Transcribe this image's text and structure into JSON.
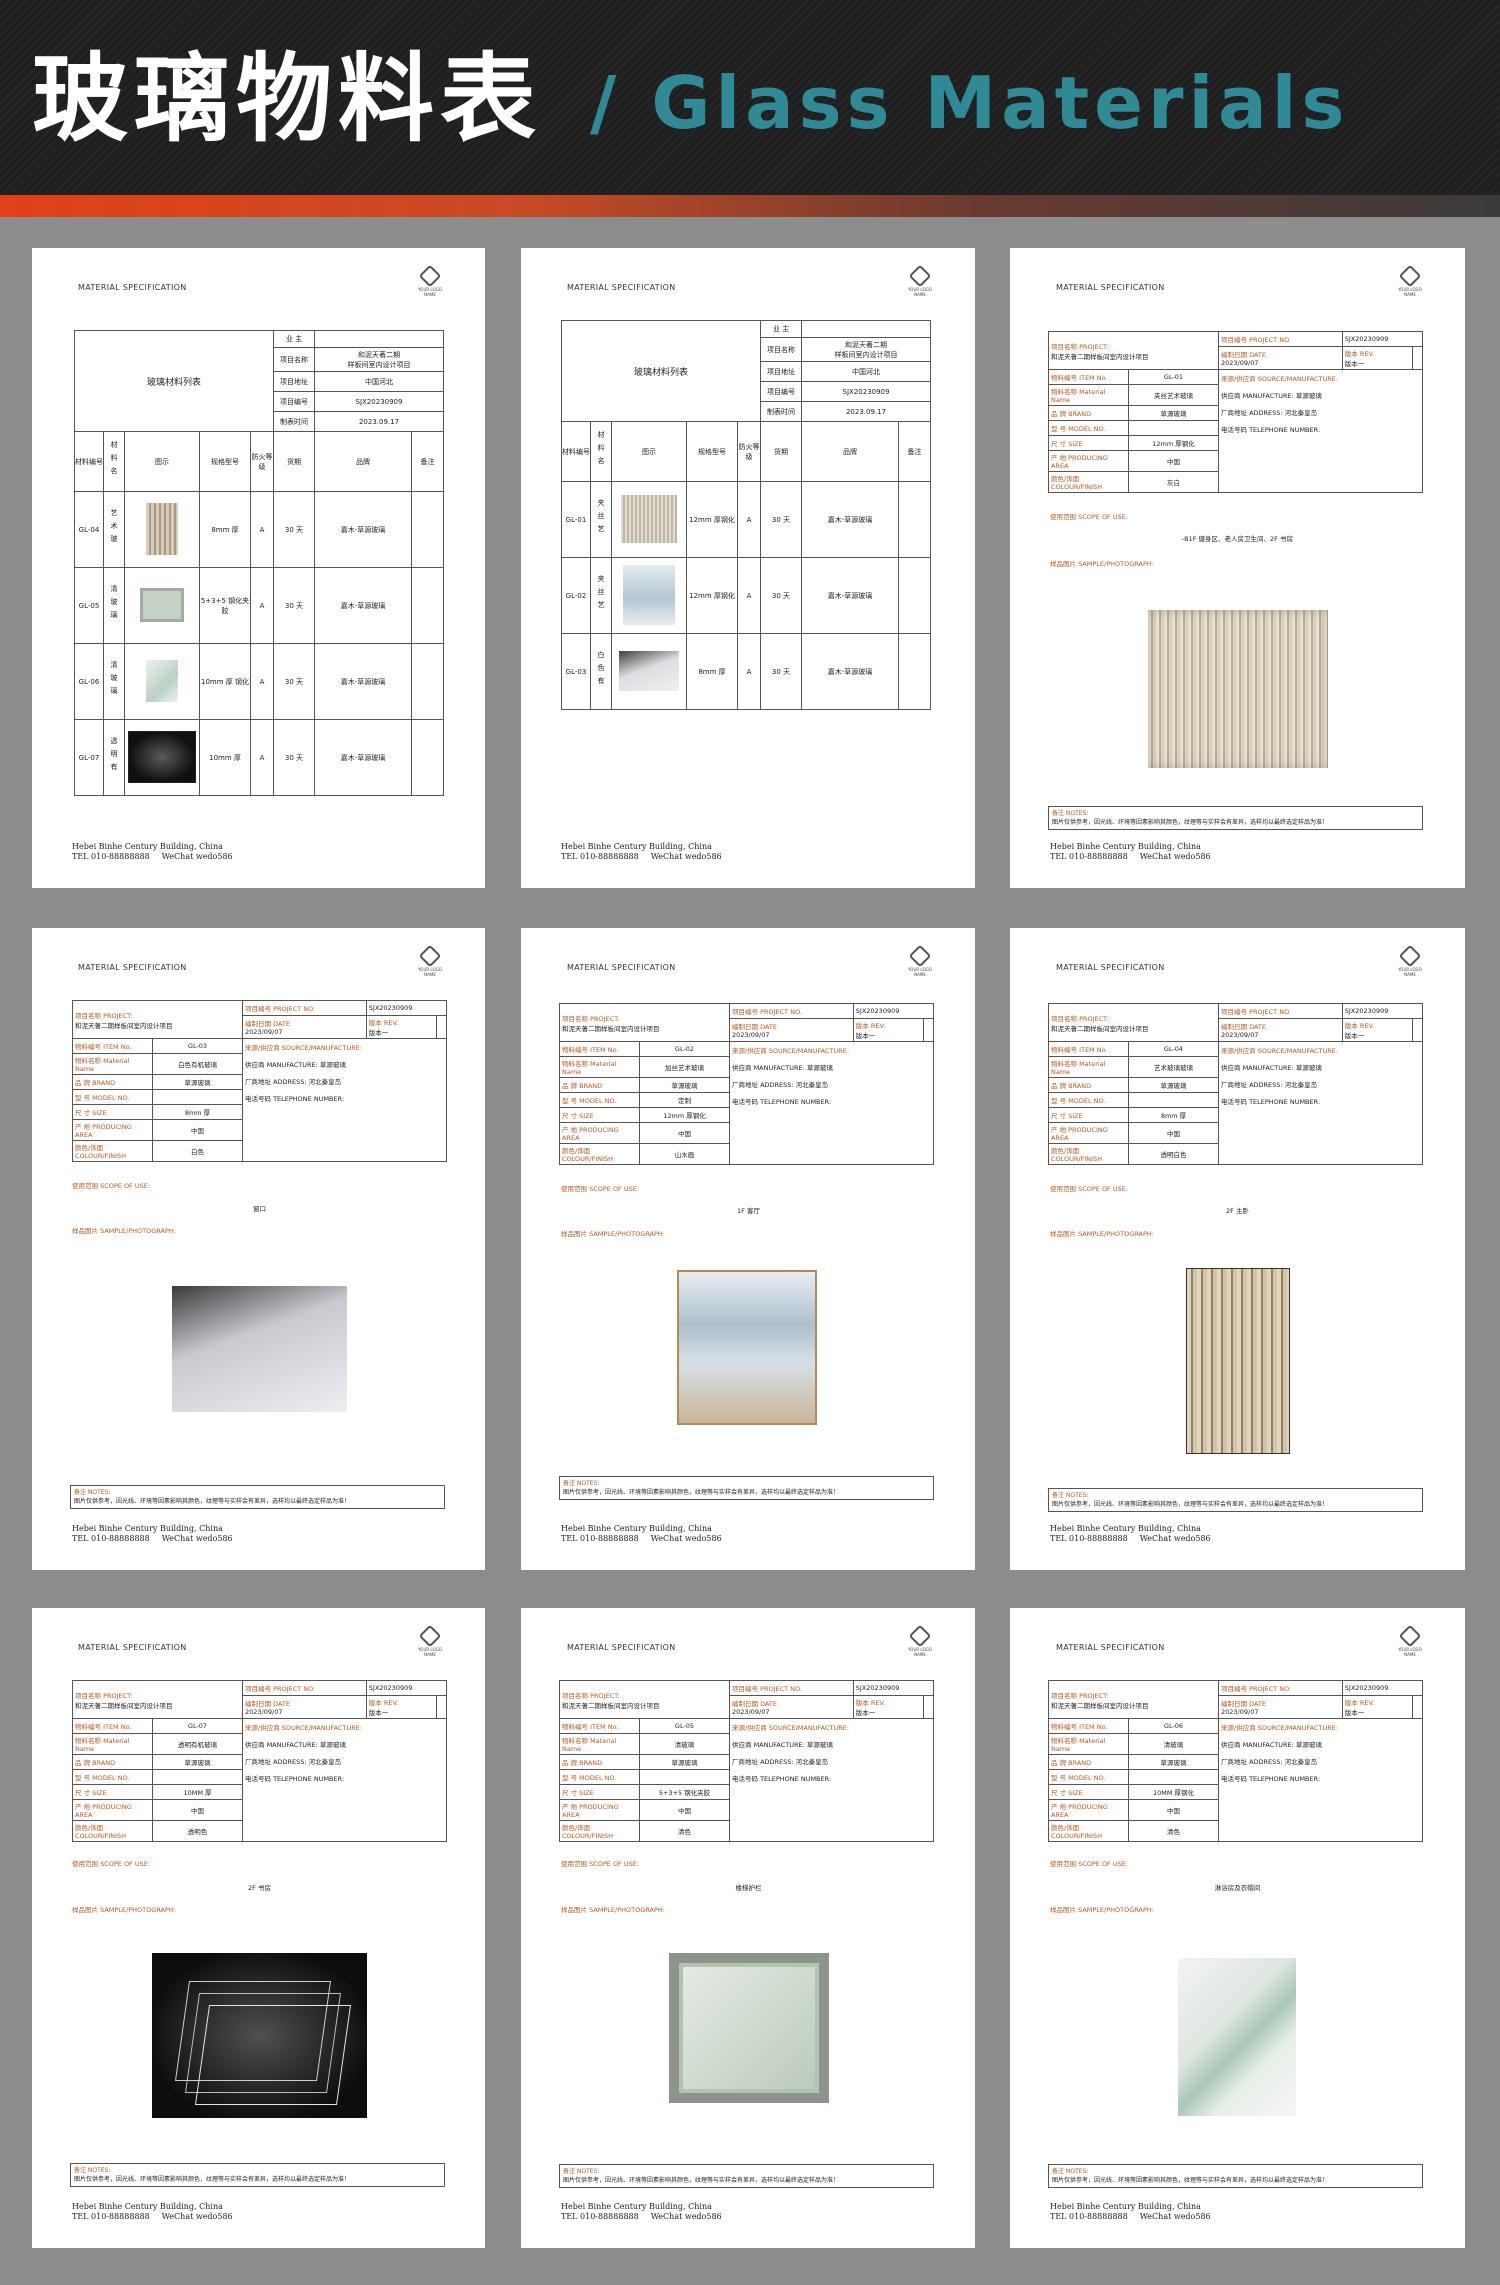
{
  "header": {
    "title_cn": "玻璃物料表",
    "title_en": "/ Glass  Materials"
  },
  "common": {
    "spec": "MATERIAL SPECIFICATION",
    "logo": "YOUR LOGO NAME",
    "footer_address": "Hebei Binhe Century Building, China",
    "footer_tel": "TEL   010-88888888",
    "footer_wechat": "WeChat   wedo586",
    "notes_label": "备注   NOTES:",
    "notes_text": "图片仅供参考，因光线、环境等因素影响其颜色，纹理等与实样会有差异，选样均以最终选定样品为准！",
    "scope_label": "使用范围   SCOPE OF USE:",
    "photo_label": "样品图片   SAMPLE/PHOTOGRAPH:"
  },
  "list_info": {
    "title": "玻璃材料列表",
    "owner_label": "业  主",
    "project_label": "项目名称",
    "project_value_1": "和泥天著二期",
    "project_value_2": "样板间室内设计项目",
    "address_label": "项目地址",
    "address_value": "中国河北",
    "code_label": "项目编号",
    "code_value": "SJX20230909",
    "date_label": "制表时间",
    "date_value": "2023.09.17",
    "col_code": "材料编号",
    "col_name": "材料名",
    "col_pic": "图示",
    "col_spec": "规格型号",
    "col_fire": "防火等级",
    "col_period": "货期",
    "col_brand": "品牌",
    "col_note": "备注"
  },
  "list1": [
    {
      "code": "GL-04",
      "name": "艺术玻",
      "spec": "8mm 厚",
      "fire": "A",
      "period": "30 天",
      "brand": "嘉木-草源玻璃"
    },
    {
      "code": "GL-05",
      "name": "清玻璃",
      "spec": "5+3+5 钢化夹胶",
      "fire": "A",
      "period": "30 天",
      "brand": "嘉木-草源玻璃"
    },
    {
      "code": "GL-06",
      "name": "清玻璃",
      "spec": "10mm 厚 钢化",
      "fire": "A",
      "period": "30 天",
      "brand": "嘉木-草源玻璃"
    },
    {
      "code": "GL-07",
      "name": "透明有",
      "spec": "10mm 厚",
      "fire": "A",
      "period": "30 天",
      "brand": "嘉木-草源玻璃"
    }
  ],
  "list2": [
    {
      "code": "GL-01",
      "name": "夹丝艺",
      "spec": "12mm 厚钢化",
      "fire": "A",
      "period": "30 天",
      "brand": "嘉木-草源玻璃"
    },
    {
      "code": "GL-02",
      "name": "夹丝艺",
      "spec": "12mm 厚钢化",
      "fire": "A",
      "period": "30 天",
      "brand": "嘉木-草源玻璃"
    },
    {
      "code": "GL-03",
      "name": "白色有",
      "spec": "8mm 厚",
      "fire": "A",
      "period": "30 天",
      "brand": "嘉木-草源玻璃"
    }
  ],
  "detail_labels": {
    "project": "项目名称   PROJECT:",
    "project_value": "和泥天著二期样板间室内设计项目",
    "projno": "项目编号   PROJECT NO.",
    "projno_value": "SJX20230909",
    "date": "编制日期   DATE",
    "date_value": "2023/09/07",
    "rev": "版本   REV.",
    "rev_value": "版本一",
    "item": "物料编号   ITEM No.",
    "mname": "物料名称   Material Name",
    "brand": "品    牌   BRAND",
    "model": "型    号   MODEL NO.",
    "size": "尺    寸   SIZE",
    "area": "产    地   PRODUCING AREA",
    "colour": "颜色/饰面 COLOUR/FINISH",
    "source": "来源/供应商   SOURCE/MANUFACTURE:",
    "supplier": "供应商   MANUFACTURE:",
    "supplier_value": "草源玻璃",
    "address": "厂商地址   ADDRESS:",
    "address_value": "河北秦皇岛",
    "tel": "电话号码   TELEPHONE NUMBER:"
  },
  "details": [
    {
      "item": "GL-01",
      "name": "夹丝艺术玻璃",
      "brand": "草源玻璃",
      "model": "",
      "size": "12mm 厚钢化",
      "area": "中国",
      "colour": "灰白",
      "scope": "-B1F 健身区、老人房卫生间、2F 书房"
    },
    {
      "item": "GL-03",
      "name": "白色有机玻璃",
      "brand": "草源玻璃",
      "model": "",
      "size": "8mm 厚",
      "area": "中国",
      "colour": "白色",
      "scope": "窗口"
    },
    {
      "item": "GL-02",
      "name": "加丝艺术玻璃",
      "brand": "草源玻璃",
      "model": "定制",
      "size": "12mm 厚钢化",
      "area": "中国",
      "colour": "山水画",
      "scope": "1F 客厅"
    },
    {
      "item": "GL-04",
      "name": "艺术玻璃玻璃",
      "brand": "草源玻璃",
      "model": "",
      "size": "8mm 厚",
      "area": "中国",
      "colour": "透明白色",
      "scope": "2F 主卧"
    },
    {
      "item": "GL-07",
      "name": "透明有机玻璃",
      "brand": "草源玻璃",
      "model": "",
      "size": "10MM 厚",
      "area": "中国",
      "colour": "透明色",
      "scope": "2F 书房"
    },
    {
      "item": "GL-05",
      "name": "清玻璃",
      "brand": "草源玻璃",
      "model": "",
      "size": "5+3+5 钢化夹胶",
      "area": "中国",
      "colour": "清色",
      "scope": "楼梯护栏"
    },
    {
      "item": "GL-06",
      "name": "清玻璃",
      "brand": "草源玻璃",
      "model": "",
      "size": "10MM 厚钢化",
      "area": "中国",
      "colour": "清色",
      "scope": "淋浴房及衣帽间"
    }
  ]
}
